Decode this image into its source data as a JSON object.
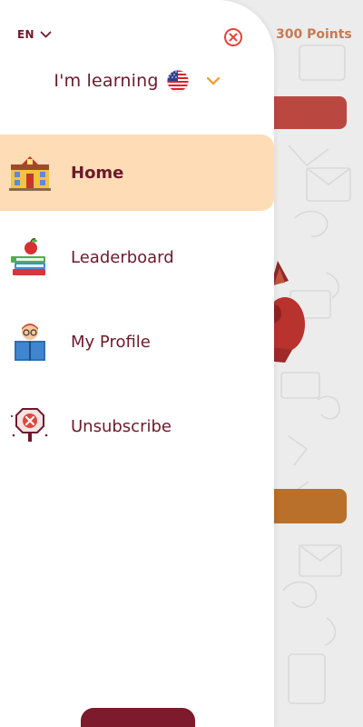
{
  "background": {
    "points_label": "300 Points",
    "colors": {
      "points": "#c77a52",
      "top_button": "#b53a32",
      "bottom_button": "#b8702a"
    }
  },
  "drawer": {
    "language": {
      "code": "EN",
      "icon": "chevron-down-icon"
    },
    "close_icon": "close-circle-icon",
    "learning": {
      "label": "I'm learning",
      "flag_icon": "us-flag-icon",
      "dropdown_icon": "chevron-down-icon"
    },
    "menu": [
      {
        "label": "Home",
        "icon": "school-icon",
        "active": true
      },
      {
        "label": "Leaderboard",
        "icon": "books-apple-icon",
        "active": false
      },
      {
        "label": "My Profile",
        "icon": "reader-avatar-icon",
        "active": false
      },
      {
        "label": "Unsubscribe",
        "icon": "stop-sign-icon",
        "active": false
      }
    ],
    "colors": {
      "text": "#6b1a2b",
      "active_bg": "#fedcb6",
      "accent_orange": "#f0a234",
      "close_red": "#e0463b",
      "footer_button": "#7d1a2b"
    }
  }
}
